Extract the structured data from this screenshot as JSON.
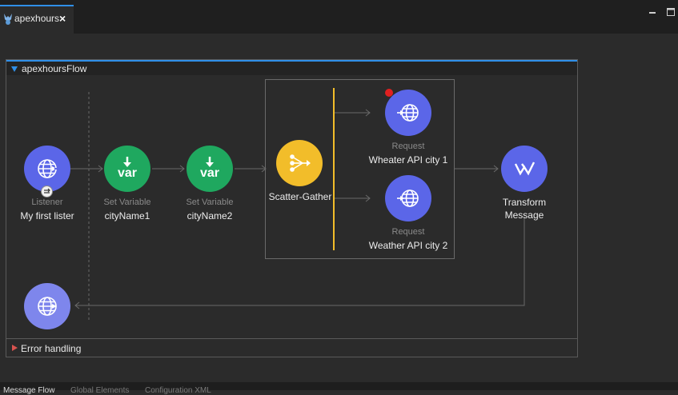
{
  "tab": {
    "title": "apexhours",
    "close_icon": "×"
  },
  "flow": {
    "title": "apexhoursFlow",
    "error_handling_label": "Error handling",
    "nodes": {
      "listener": {
        "type": "Listener",
        "name": "My first lister"
      },
      "setvar1": {
        "type": "Set Variable",
        "name": "cityName1",
        "icon_text": "var"
      },
      "setvar2": {
        "type": "Set Variable",
        "name": "cityName2",
        "icon_text": "var"
      },
      "scatter": {
        "name": "Scatter-Gather"
      },
      "request1": {
        "type": "Request",
        "name": "Wheater API city 1"
      },
      "request2": {
        "type": "Request",
        "name": "Weather API city 2"
      },
      "transform": {
        "name_line1": "Transform",
        "name_line2": "Message"
      }
    }
  },
  "bottom_tabs": [
    "Message Flow",
    "Global Elements",
    "Configuration XML"
  ],
  "colors": {
    "accent": "#2f8fe8",
    "http_node": "#5b66e8",
    "setvar_node": "#1fa85f",
    "scatter_node": "#f2bd2a",
    "error_marker": "#e02020",
    "scatter_bar": "#f2bd2a"
  }
}
